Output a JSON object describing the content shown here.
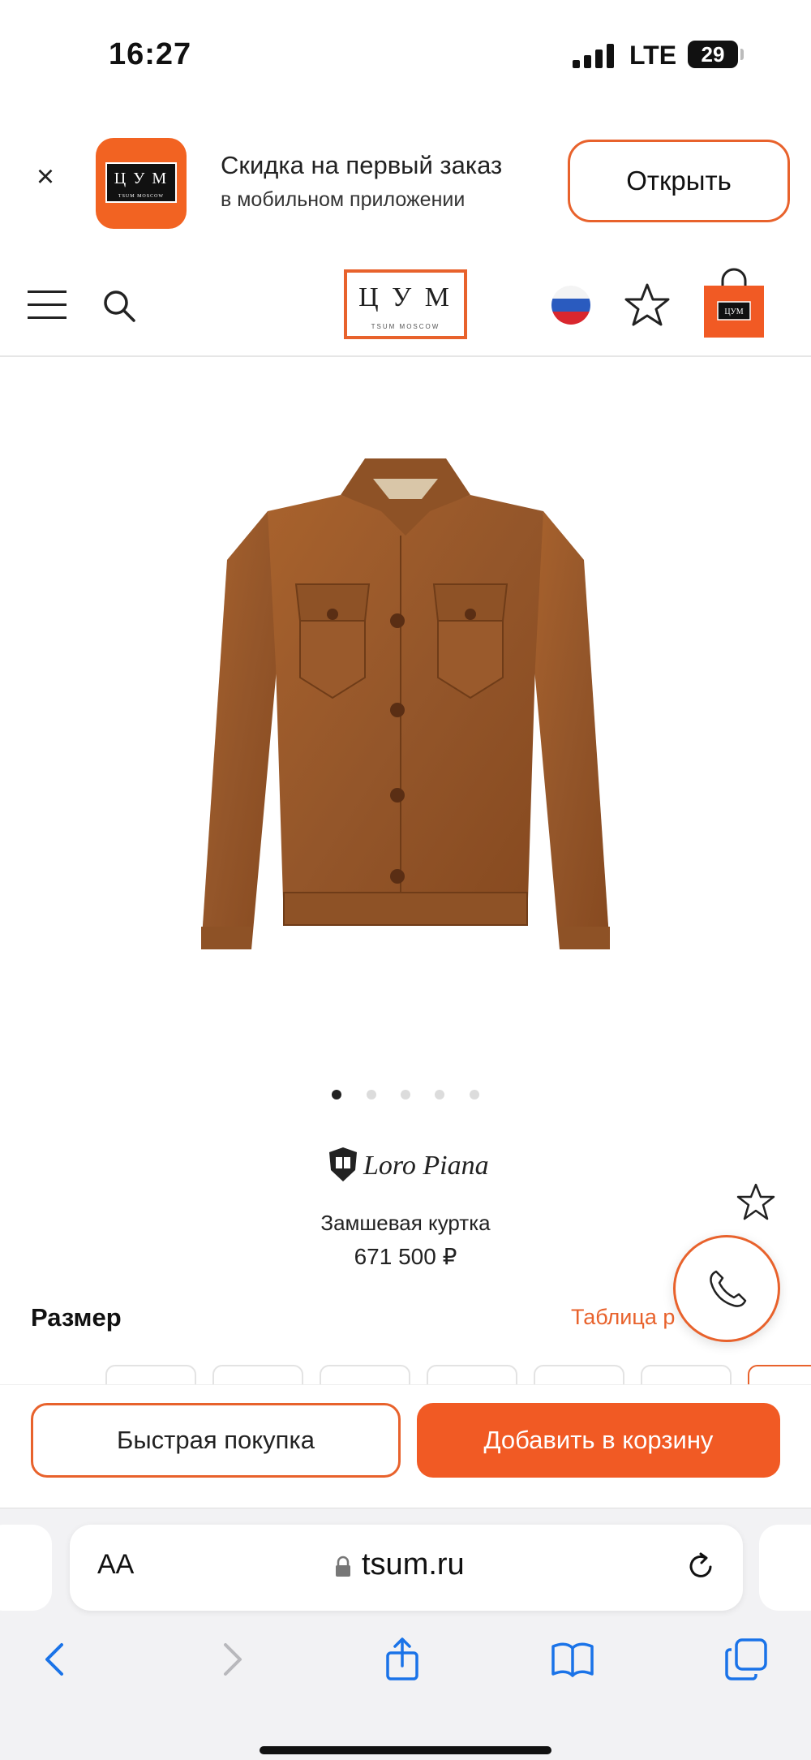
{
  "status_bar": {
    "time": "16:27",
    "network": "LTE",
    "battery": "29"
  },
  "app_banner": {
    "close": "×",
    "title": "Скидка на первый заказ",
    "subtitle": "в мобильном приложении",
    "open_button": "Открыть",
    "app_icon_text": "Ц У М",
    "app_icon_sub": "TSUM MOSCOW"
  },
  "header": {
    "logo_text": "Ц У М",
    "logo_sub": "TSUM MOSCOW"
  },
  "product": {
    "brand": "Loro Piana",
    "title": "Замшевая куртка",
    "price": "671 500 ₽",
    "image_count": 5,
    "active_image": 1
  },
  "size": {
    "label": "Размер",
    "table_link": "Таблица р"
  },
  "actions": {
    "quick_buy": "Быстрая покупка",
    "add_to_cart": "Добавить в корзину"
  },
  "browser": {
    "aa": "AA",
    "url": "tsum.ru"
  },
  "colors": {
    "accent": "#e8622c",
    "button": "#f15a24",
    "jacket": "#9a5a2c"
  }
}
